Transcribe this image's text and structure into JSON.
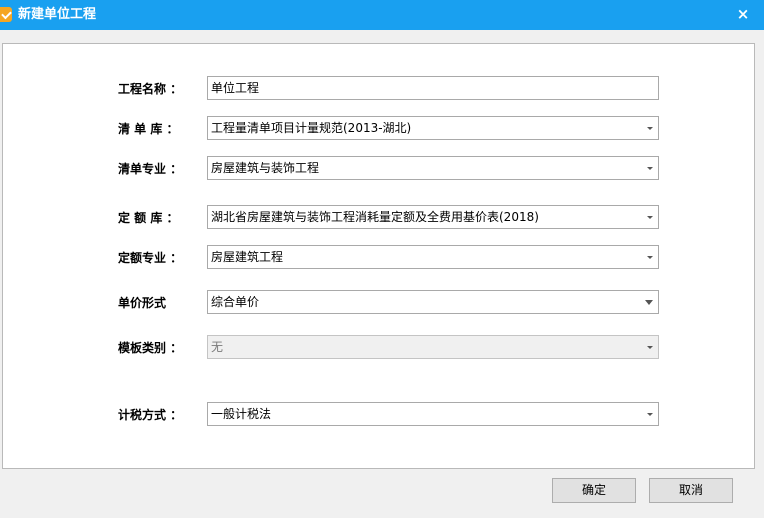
{
  "window": {
    "title": "新建单位工程",
    "close_glyph": "×"
  },
  "form": {
    "project_name": {
      "label": "工程名称 ：",
      "value": "单位工程"
    },
    "bill_library": {
      "label": "清 单 库 ：",
      "value": "工程量清单项目计量规范(2013-湖北)"
    },
    "bill_specialty": {
      "label": "清单专业 ：",
      "value": "房屋建筑与装饰工程"
    },
    "quota_library": {
      "label": "定 额 库 ：",
      "value": "湖北省房屋建筑与装饰工程消耗量定额及全费用基价表(2018)"
    },
    "quota_specialty": {
      "label": "定额专业 ：",
      "value": "房屋建筑工程"
    },
    "unit_price_form": {
      "label": "单价形式",
      "value": "综合单价"
    },
    "template_category": {
      "label": "模板类别 ：",
      "value": "无"
    },
    "tax_method": {
      "label": "计税方式 ：",
      "value": "一般计税法"
    }
  },
  "buttons": {
    "ok": "确定",
    "cancel": "取消"
  }
}
